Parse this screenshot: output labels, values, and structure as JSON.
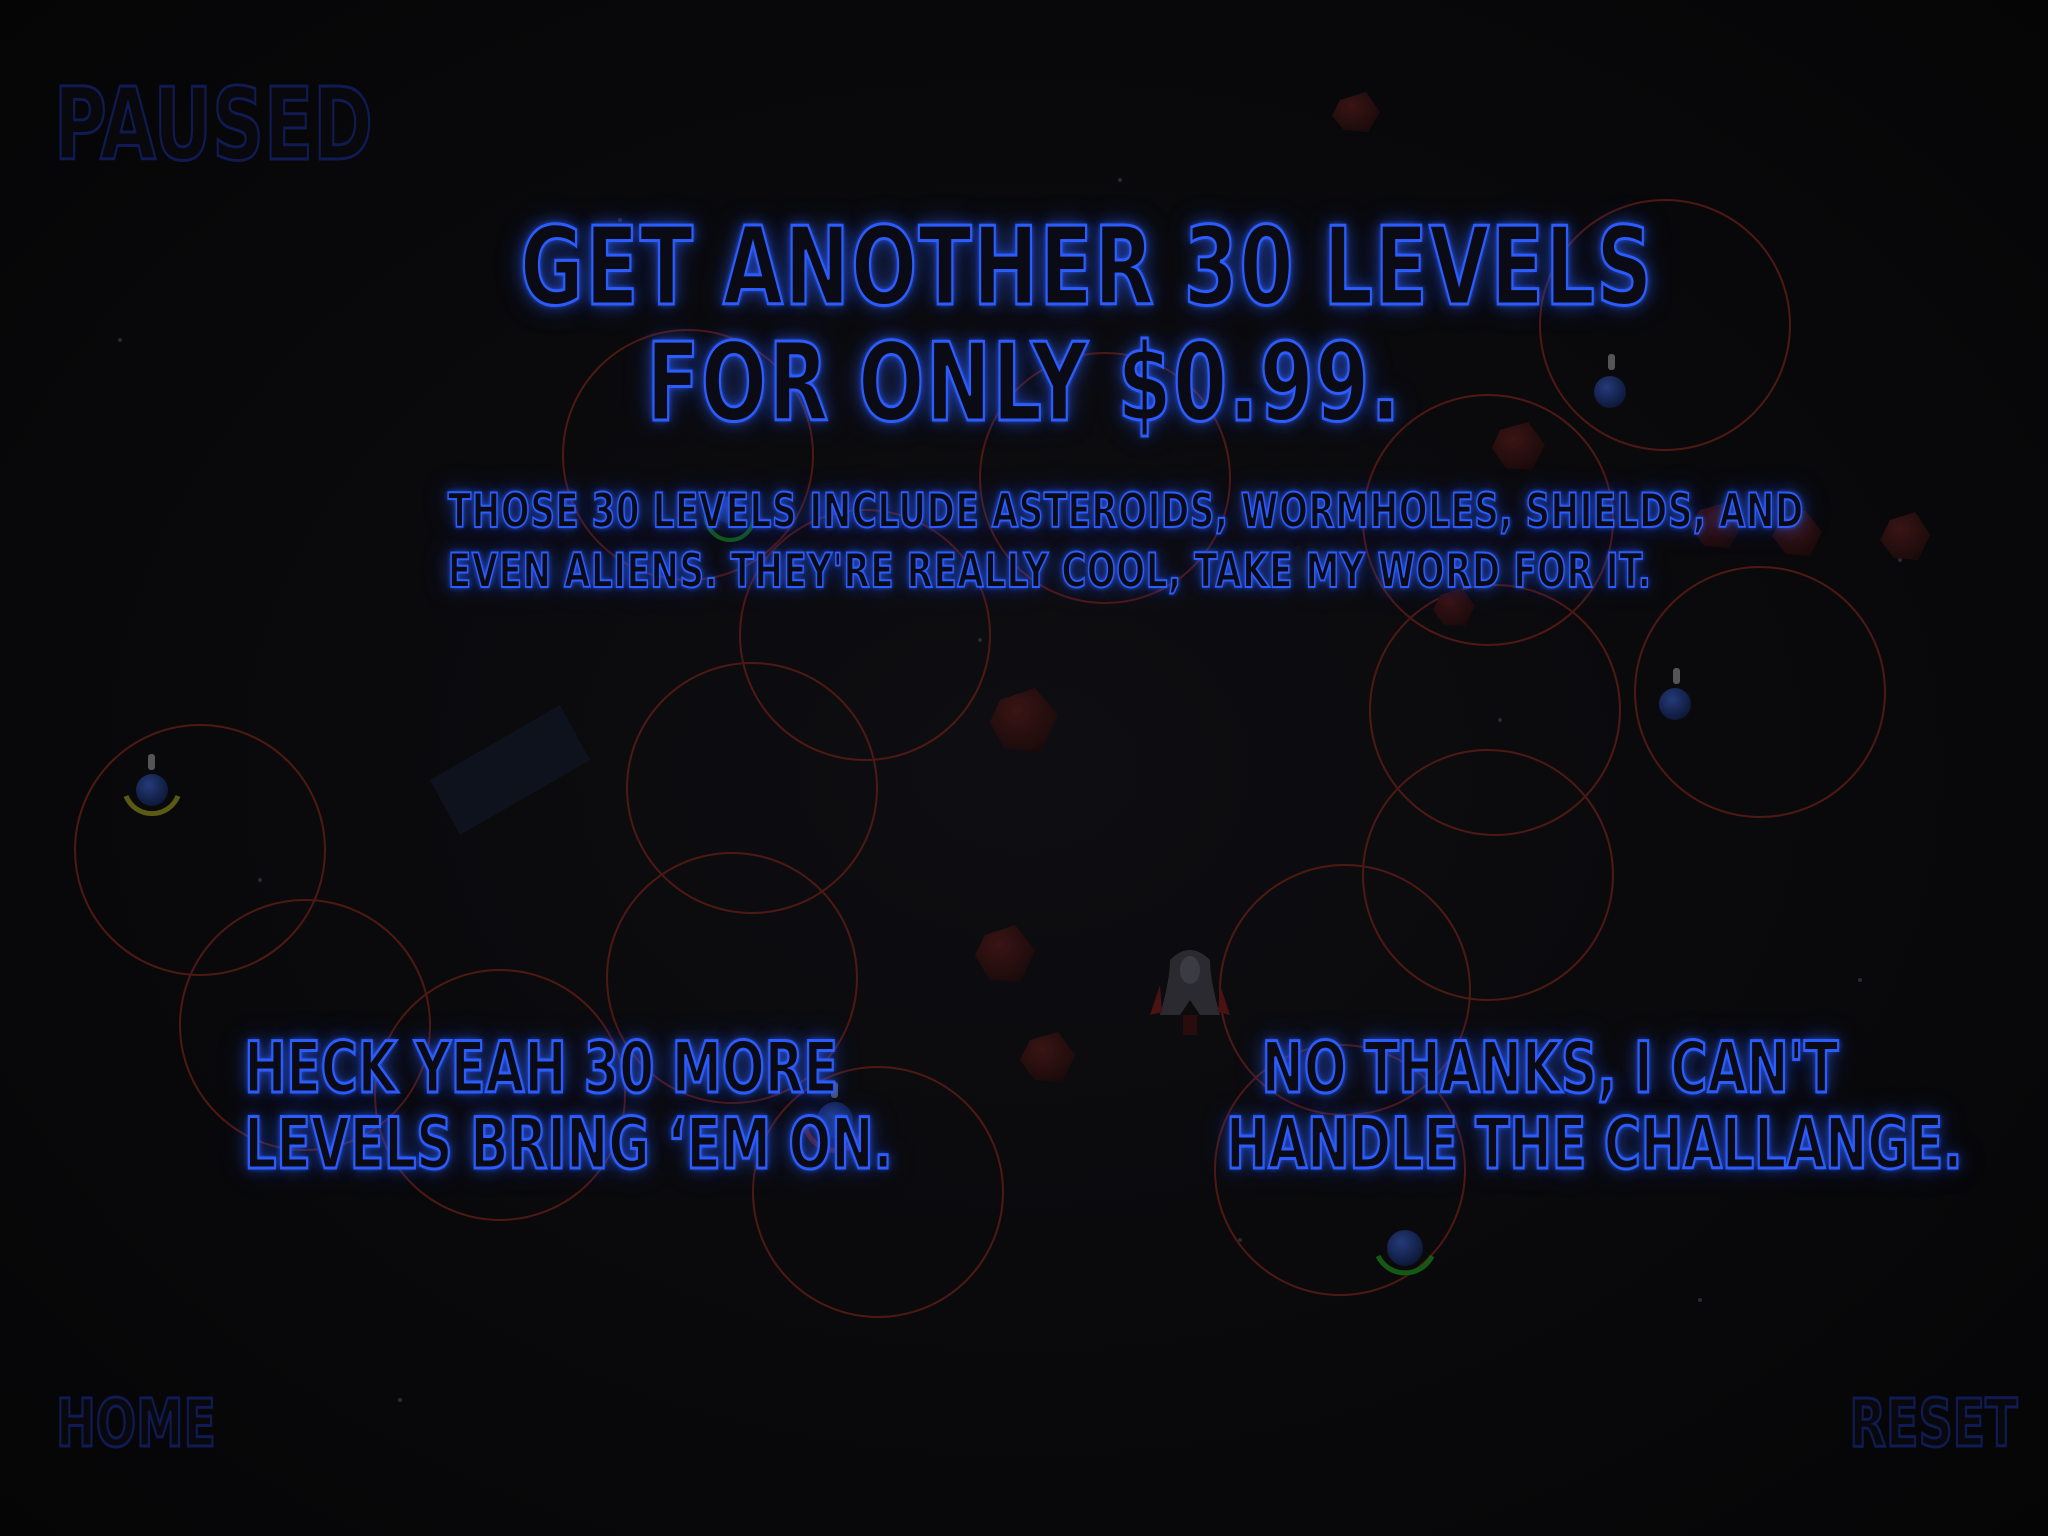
{
  "hud": {
    "paused_label": "PAUSED",
    "home_label": "HOME",
    "reset_label": "RESET"
  },
  "offer": {
    "title_line1": "GET ANOTHER 30 LEVELS",
    "title_line2": "FOR ONLY $0.99.",
    "description_line1": "THOSE 30 LEVELS INCLUDE ASTEROIDS, WORMHOLES, SHIELDS, AND",
    "description_line2": "EVEN ALIENS. THEY'RE REALLY COOL, TAKE MY WORD FOR IT.",
    "accept_line1": "HECK YEAH 30 MORE",
    "accept_line2": "LEVELS BRING ‘EM ON.",
    "decline_line1": "NO THANKS, I CAN'T",
    "decline_line2": "HANDLE THE CHALLANGE."
  },
  "colors": {
    "neon": "#2b5cff",
    "dim_text": "#0f1b52",
    "orbit": "#5a1c14",
    "background": "#070709"
  },
  "icons": {
    "astronaut": "astronaut-icon",
    "planet": "planet-icon",
    "rocket": "rocket-icon",
    "asteroid": "asteroid-icon"
  }
}
